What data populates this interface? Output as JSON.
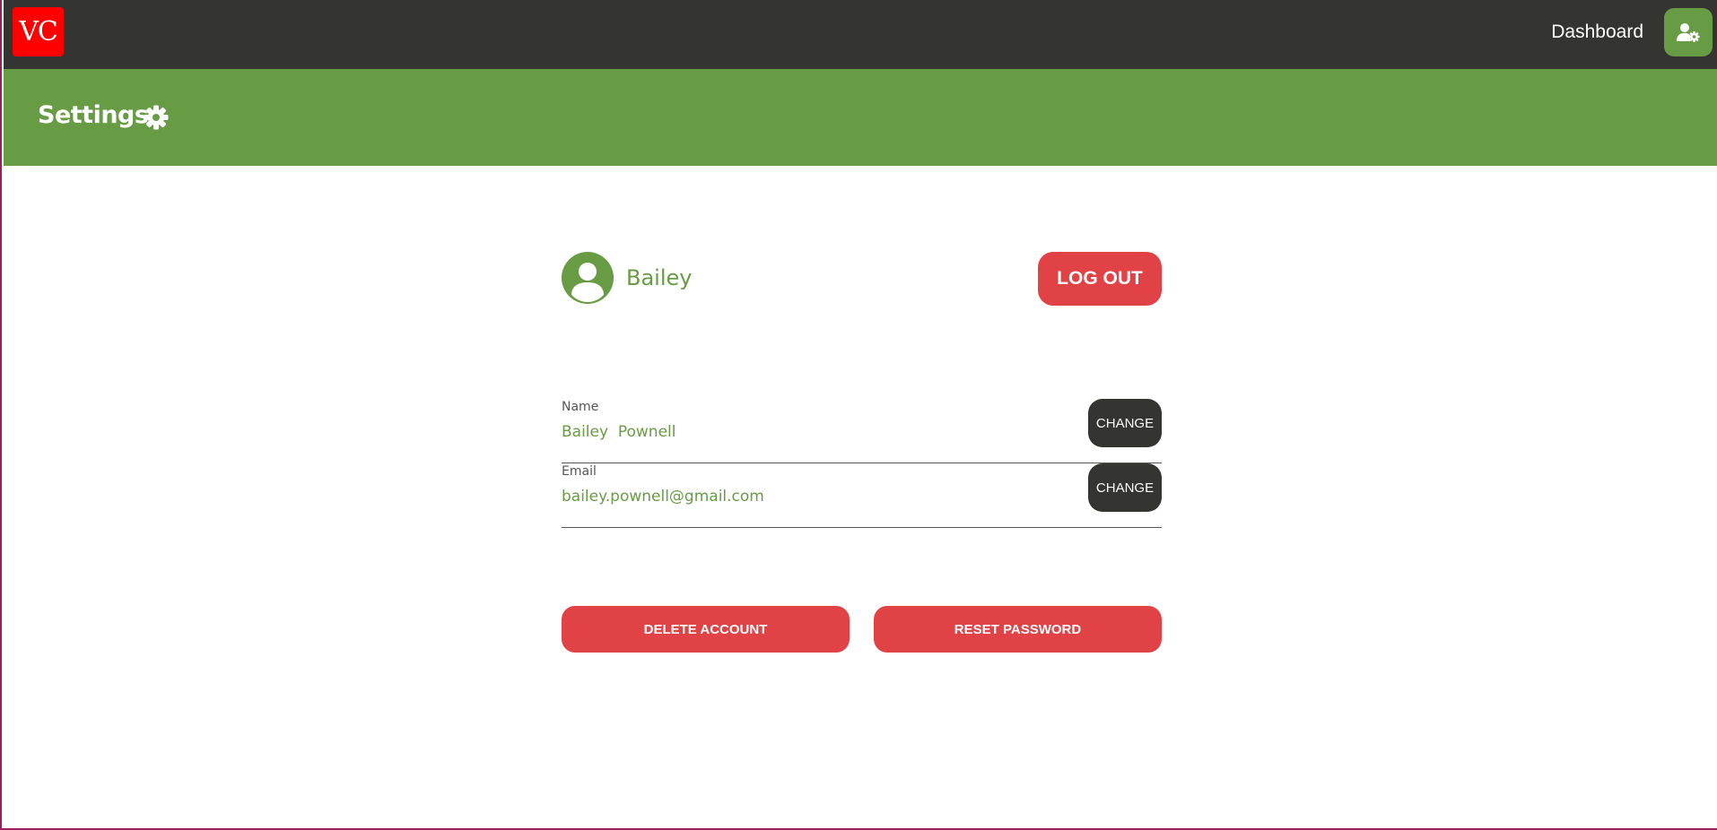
{
  "nav": {
    "logo_text": "VC",
    "dashboard_label": "Dashboard",
    "user_settings_icon": "user-gear-icon"
  },
  "header": {
    "title": "Settings",
    "title_icon": "gear-icon"
  },
  "profile": {
    "display_name": "Bailey",
    "avatar_icon": "user-avatar-icon",
    "logout_label": "LOG OUT"
  },
  "fields": [
    {
      "label": "Name",
      "value": "Bailey  Pownell",
      "button_label": "CHANGE"
    },
    {
      "label": "Email",
      "value": "bailey.pownell@gmail.com",
      "button_label": "CHANGE"
    }
  ],
  "actions": {
    "delete_label": "DELETE ACCOUNT",
    "reset_label": "RESET PASSWORD"
  },
  "colors": {
    "topbar": "#343430",
    "brand_green": "#689c44",
    "danger_red": "#e04245",
    "logo_red": "#ff0000",
    "dark_button": "#343430"
  }
}
